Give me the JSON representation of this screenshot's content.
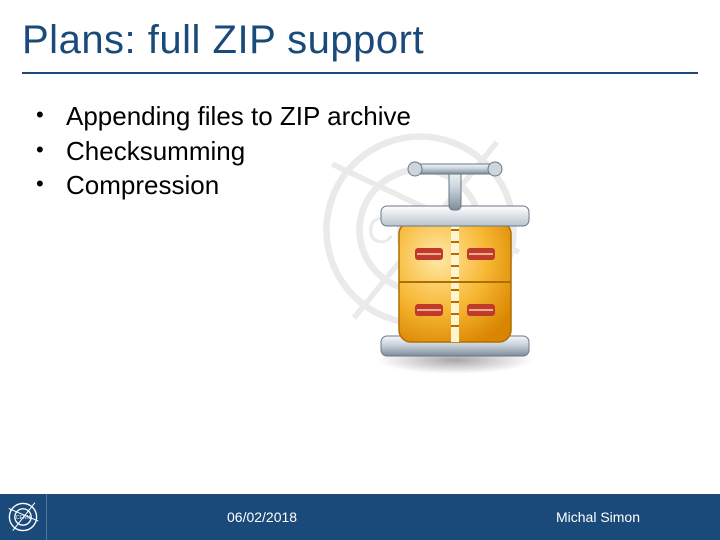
{
  "title": "Plans: full ZIP support",
  "bullets": [
    "Appending files to ZIP archive",
    "Checksumming",
    "Compression"
  ],
  "footer": {
    "date": "06/02/2018",
    "author": "Michal Simon"
  },
  "watermark_text": "CERN"
}
